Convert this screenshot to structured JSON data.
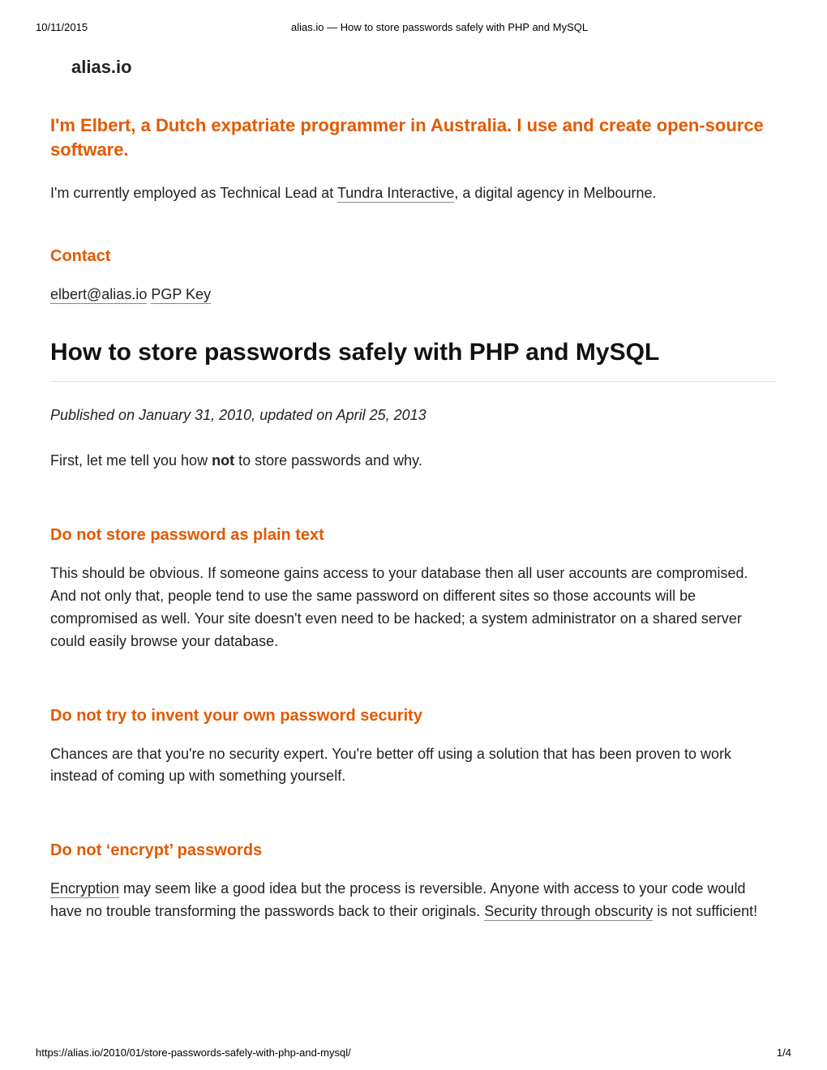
{
  "print": {
    "date": "10/11/2015",
    "header_title": "alias.io — How to store passwords safely with PHP and MySQL",
    "url": "https://alias.io/2010/01/store-passwords-safely-with-php-and-mysql/",
    "page": "1/4"
  },
  "site": {
    "title": "alias.io"
  },
  "intro": {
    "heading": "I'm Elbert, a Dutch expatriate programmer in Australia. I use and create open-source software.",
    "employ_pre": "I'm currently employed as Technical Lead at ",
    "employ_link": "Tundra Interactive",
    "employ_post": ", a digital agency in Melbourne."
  },
  "contact": {
    "heading": "Contact",
    "email": "elbert@alias.io",
    "pgp": "PGP Key"
  },
  "article": {
    "title": "How to store passwords safely with PHP and MySQL",
    "meta": "Published on January 31, 2010, updated on April 25, 2013",
    "first_pre": "First, let me tell you how ",
    "first_bold": "not",
    "first_post": " to store passwords and why."
  },
  "s1": {
    "heading": "Do not store password as plain text",
    "body": "This should be obvious. If someone gains access to your database then all user accounts are compromised. And not only that, people tend to use the same password on different sites so those accounts will be compromised as well. Your site doesn't even need to be hacked; a system administrator on a shared server could easily browse your database."
  },
  "s2": {
    "heading": "Do not try to invent your own password security",
    "body": "Chances are that you're no security expert. You're better off using a solution that has been proven to work instead of coming up with something yourself."
  },
  "s3": {
    "heading": "Do not ‘encrypt’ passwords",
    "body_link1": "Encryption",
    "body_mid": " may seem like a good idea but the process is reversible. Anyone with access to your code would have no trouble transforming the passwords back to their originals. ",
    "body_link2": "Security through obscurity",
    "body_post": " is not sufficient!"
  }
}
